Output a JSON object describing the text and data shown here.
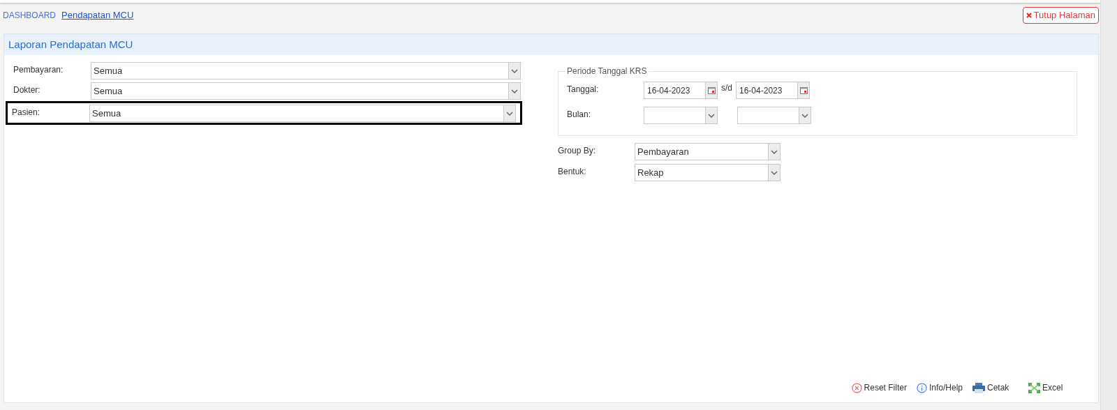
{
  "breadcrumb": [
    {
      "label": "DASHBOARD",
      "selected": false
    },
    {
      "label": "Pendapatan MCU",
      "selected": true
    }
  ],
  "close_button": {
    "label": "Tutup Halaman"
  },
  "panel": {
    "title": "Laporan Pendapatan MCU"
  },
  "filters": [
    {
      "label": "Pembayaran:",
      "value": "Semua",
      "highlighted": false
    },
    {
      "label": "Dokter:",
      "value": "Semua",
      "highlighted": false
    },
    {
      "label": "Pasien:",
      "value": "Semua",
      "highlighted": true
    }
  ],
  "period": {
    "legend": "Periode Tanggal KRS",
    "date_label": "Tanggal:",
    "date_from": "16-04-2023",
    "separator": "s/d",
    "date_to": "16-04-2023",
    "month_label": "Bulan:"
  },
  "options": [
    {
      "label": "Group By:",
      "value": "Pembayaran"
    },
    {
      "label": "Bentuk:",
      "value": "Rekap"
    }
  ],
  "actions": [
    {
      "kind": "reset",
      "label": "Reset Filter"
    },
    {
      "kind": "info",
      "label": "Info/Help"
    },
    {
      "kind": "print",
      "label": "Cetak"
    },
    {
      "kind": "excel",
      "label": "Excel"
    }
  ]
}
